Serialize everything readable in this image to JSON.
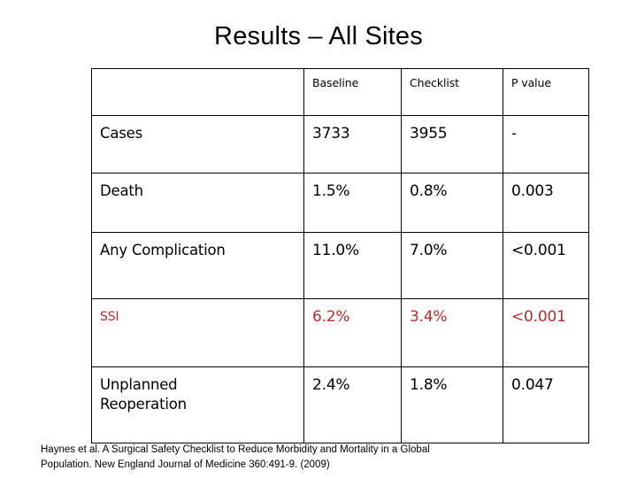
{
  "slide": {
    "title": "Results – All Sites"
  },
  "table": {
    "columns": [
      "",
      "Baseline",
      "Checklist",
      "P value"
    ],
    "rows": [
      {
        "label": "Cases",
        "label_line2": "",
        "baseline": "3733",
        "checklist": "3955",
        "p_value": "-",
        "highlight": false
      },
      {
        "label": "Death",
        "label_line2": "",
        "baseline": "1.5%",
        "checklist": "0.8%",
        "p_value": "0.003",
        "highlight": false
      },
      {
        "label": "Any Complication",
        "label_line2": "",
        "baseline": "11.0%",
        "checklist": "7.0%",
        "p_value": "<0.001",
        "highlight": false
      },
      {
        "label": "SSI",
        "label_line2": "",
        "baseline": "6.2%",
        "checklist": "3.4%",
        "p_value": "<0.001",
        "highlight": true
      },
      {
        "label": "Unplanned",
        "label_line2": "Reoperation",
        "baseline": "2.4%",
        "checklist": "1.8%",
        "p_value": "0.047",
        "highlight": false
      }
    ]
  },
  "citation": {
    "line1": "Haynes et al. A Surgical Safety Checklist to Reduce Morbidity and Mortality in a Global",
    "line2": "Population. New England Journal of Medicine 360:491-9. (2009)"
  },
  "colors": {
    "highlight_text": "#bf2a2a",
    "text": "#000000",
    "border": "#000000",
    "background": "#ffffff"
  }
}
